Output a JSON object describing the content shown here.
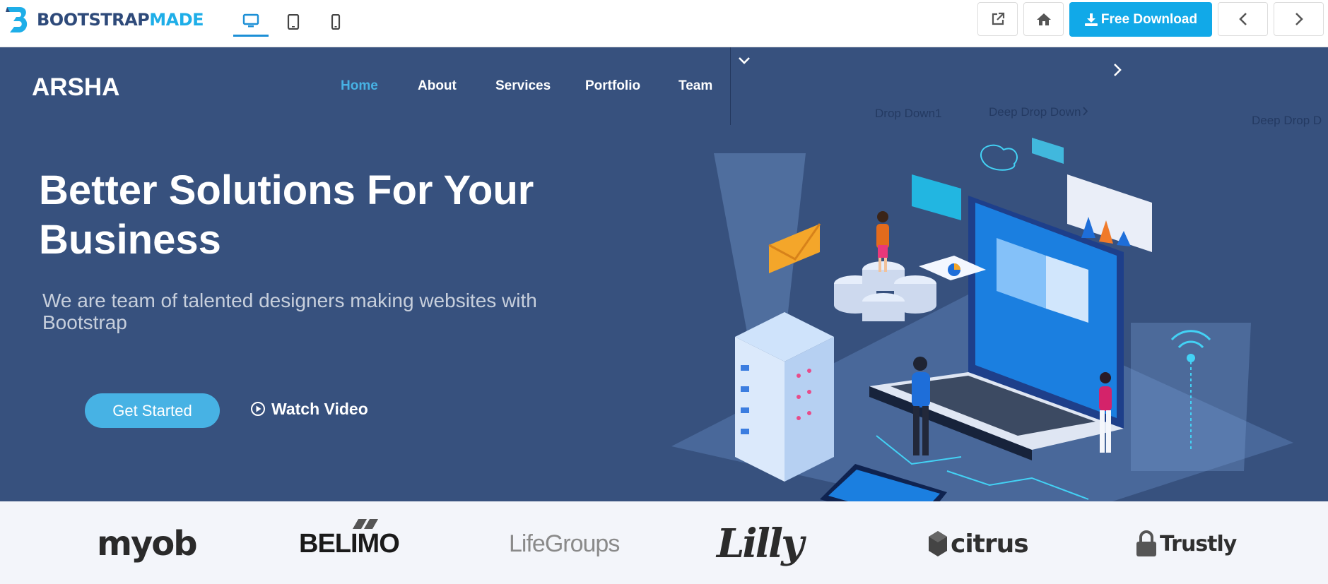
{
  "toolbar": {
    "brand_part1": "BOOTSTRAP",
    "brand_part2": "MADE",
    "device_icons": [
      "desktop-icon",
      "tablet-icon",
      "mobile-icon"
    ],
    "active_device": "desktop",
    "download_label": "Free Download",
    "icons": [
      "external-link-icon",
      "home-icon",
      "download-icon",
      "chevron-left-icon",
      "chevron-right-icon"
    ]
  },
  "site": {
    "logo": "ARSHA",
    "nav": [
      "Home",
      "About",
      "Services",
      "Portfolio",
      "Team"
    ],
    "active_nav": "Home",
    "dropdown": {
      "item1": "Drop Down1",
      "item2": "Deep Drop Down",
      "item3": "Deep Drop D"
    }
  },
  "hero": {
    "title": "Better Solutions For Your Business",
    "subtitle": "We are team of talented designers making websites with Bootstrap",
    "cta_primary": "Get Started",
    "cta_secondary": "Watch Video"
  },
  "clients": [
    "myob",
    "BELIMO",
    "LifeGroups",
    "Lilly",
    "citrus",
    "Trustly"
  ],
  "colors": {
    "hero_bg": "#37517e",
    "accent": "#47b2e4",
    "download_btn": "#11a9e8",
    "clients_bg": "#f3f5fa"
  }
}
